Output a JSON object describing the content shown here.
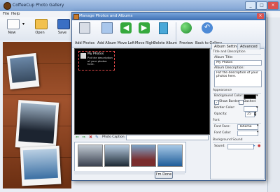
{
  "app": {
    "title": "CoffeeCup Photo Gallery",
    "menu": [
      "File",
      "Help"
    ],
    "toolbar": [
      {
        "label": "New",
        "icon": "new-document-icon"
      },
      {
        "label": "Open",
        "icon": "open-folder-icon"
      },
      {
        "label": "Save",
        "icon": "save-disk-icon"
      }
    ]
  },
  "dialog": {
    "title": "Manage Photos and Albums",
    "toolbar": [
      {
        "label": "Add Photos",
        "icon": "add-photos-icon"
      },
      {
        "label": "Add Album",
        "icon": "add-album-icon"
      },
      {
        "label": "Move Left",
        "icon": "arrow-left-icon"
      },
      {
        "label": "Move Right",
        "icon": "arrow-right-icon"
      },
      {
        "label": "Delete Album",
        "icon": "trash-icon"
      },
      {
        "label": "Preview",
        "icon": "globe-preview-icon"
      },
      {
        "label": "Back to Gallery",
        "icon": "back-arrow-icon"
      }
    ],
    "album_preview": {
      "title": "My Photos",
      "description": "Put the description of your photos here."
    },
    "caption_label": "Photo Caption:",
    "done_label": "I'm Done",
    "tabs": [
      "Album Settings",
      "Advanced"
    ],
    "settings": {
      "section_title": "Title and Description",
      "album_title_label": "Album Title:",
      "album_title_value": "My Photos",
      "album_description_label": "Album Description:",
      "album_description_value": "Put the description of your photos here.",
      "appearance_title": "Appearance",
      "bg_color_label": "Background Color:",
      "show_border_label": "Show Border",
      "dashed_label": "Dashed",
      "border_color_label": "Border Color:",
      "opacity_label": "Opacity:",
      "opacity_value": "25",
      "font_title": "Font",
      "font_face_label": "Font Face:",
      "font_face_value": "Tahoma",
      "font_color_label": "Font Color:",
      "bg_sound_title": "Background Sound",
      "sound_label": "Sound:"
    }
  }
}
